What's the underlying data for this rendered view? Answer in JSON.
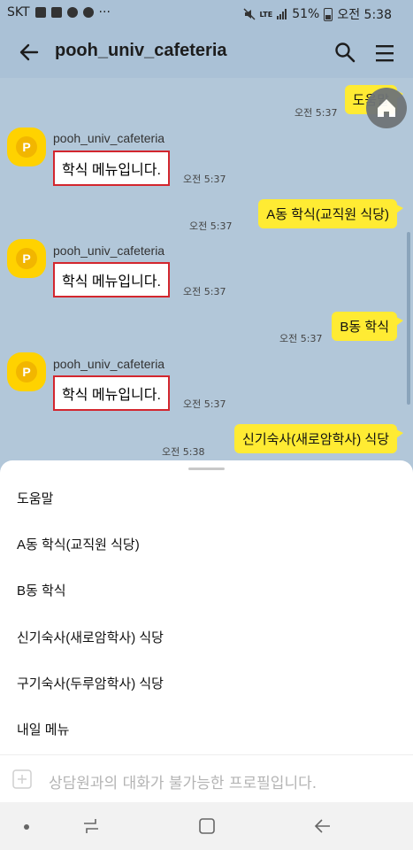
{
  "status_bar": {
    "carrier": "SKT",
    "dots": "···",
    "network": "LTE",
    "battery": "51%",
    "time": "오전 5:38"
  },
  "header": {
    "title": "pooh_univ_cafeteria"
  },
  "chat": {
    "messages": [
      {
        "side": "right",
        "text": "도움말",
        "time": "오전 5:37"
      },
      {
        "side": "left",
        "sender": "pooh_univ_cafeteria",
        "text": "학식 메뉴입니다.",
        "time": "오전 5:37"
      },
      {
        "side": "right",
        "text": "A동 학식(교직원 식당)",
        "time": "오전 5:37"
      },
      {
        "side": "left",
        "sender": "pooh_univ_cafeteria",
        "text": "학식 메뉴입니다.",
        "time": "오전 5:37"
      },
      {
        "side": "right",
        "text": "B동 학식",
        "time": "오전 5:37"
      },
      {
        "side": "left",
        "sender": "pooh_univ_cafeteria",
        "text": "학식 메뉴입니다.",
        "time": "오전 5:37"
      },
      {
        "side": "right",
        "text": "신기숙사(새로암학사) 식당",
        "time": "오전 5:38"
      }
    ]
  },
  "quick_replies": [
    "도움말",
    "A동 학식(교직원 식당)",
    "B동 학식",
    "신기숙사(새로암학사) 식당",
    "구기숙사(두루암학사) 식당",
    "내일 메뉴"
  ],
  "input": {
    "placeholder": "상담원과의 대화가 불가능한 프로필입니다."
  },
  "colors": {
    "chat_bg": "#b2c7d9",
    "my_bubble": "#ffeb33",
    "highlight_border": "#d3262e",
    "avatar": "#ffd200"
  }
}
